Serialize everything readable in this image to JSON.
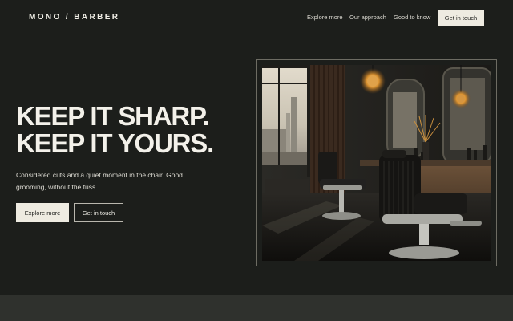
{
  "header": {
    "brand": "MONO / BARBER",
    "nav": [
      "Explore more",
      "Our approach",
      "Good to know"
    ],
    "cta": "Get in touch"
  },
  "hero": {
    "headline": [
      "KEEP IT SHARP.",
      "KEEP IT YOURS."
    ],
    "lead": "Considered cuts and a quiet moment in the chair. Good grooming, without the fuss.",
    "primary_button": "Explore more",
    "secondary_button": "Get in touch"
  },
  "colors": {
    "background": "#1c1e1b",
    "text": "#f3f1ea",
    "button_light": "#eeebe1",
    "bottom_band": "#2f312d"
  }
}
